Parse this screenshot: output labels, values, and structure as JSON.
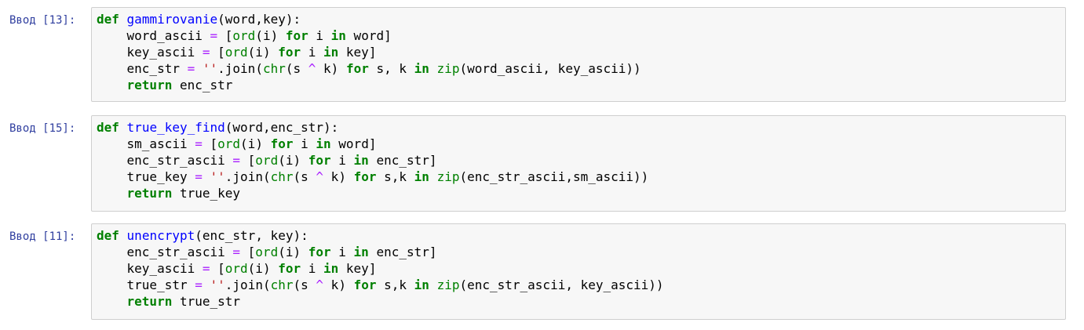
{
  "cells": [
    {
      "prompt": "Ввод [13]:",
      "lines": [
        [
          [
            "kw",
            "def"
          ],
          [
            "pn",
            " "
          ],
          [
            "fn",
            "gammirovanie"
          ],
          [
            "pn",
            "(word,key):"
          ]
        ],
        [
          [
            "pn",
            "    word_ascii "
          ],
          [
            "op",
            "="
          ],
          [
            "pn",
            " ["
          ],
          [
            "bi",
            "ord"
          ],
          [
            "pn",
            "(i) "
          ],
          [
            "kw",
            "for"
          ],
          [
            "pn",
            " i "
          ],
          [
            "kw",
            "in"
          ],
          [
            "pn",
            " word]"
          ]
        ],
        [
          [
            "pn",
            "    key_ascii "
          ],
          [
            "op",
            "="
          ],
          [
            "pn",
            " ["
          ],
          [
            "bi",
            "ord"
          ],
          [
            "pn",
            "(i) "
          ],
          [
            "kw",
            "for"
          ],
          [
            "pn",
            " i "
          ],
          [
            "kw",
            "in"
          ],
          [
            "pn",
            " key]"
          ]
        ],
        [
          [
            "pn",
            "    enc_str "
          ],
          [
            "op",
            "="
          ],
          [
            "pn",
            " "
          ],
          [
            "st",
            "''"
          ],
          [
            "pn",
            "."
          ],
          [
            "pn",
            "join("
          ],
          [
            "bi",
            "chr"
          ],
          [
            "pn",
            "(s "
          ],
          [
            "op",
            "^"
          ],
          [
            "pn",
            " k) "
          ],
          [
            "kw",
            "for"
          ],
          [
            "pn",
            " s, k "
          ],
          [
            "kw",
            "in"
          ],
          [
            "pn",
            " "
          ],
          [
            "bi",
            "zip"
          ],
          [
            "pn",
            "(word_ascii, key_ascii))"
          ]
        ],
        [
          [
            "pn",
            "    "
          ],
          [
            "kw",
            "return"
          ],
          [
            "pn",
            " enc_str"
          ]
        ]
      ]
    },
    {
      "prompt": "Ввод [15]:",
      "lines": [
        [
          [
            "kw",
            "def"
          ],
          [
            "pn",
            " "
          ],
          [
            "fn",
            "true_key_find"
          ],
          [
            "pn",
            "(word,enc_str):"
          ]
        ],
        [
          [
            "pn",
            "    sm_ascii "
          ],
          [
            "op",
            "="
          ],
          [
            "pn",
            " ["
          ],
          [
            "bi",
            "ord"
          ],
          [
            "pn",
            "(i) "
          ],
          [
            "kw",
            "for"
          ],
          [
            "pn",
            " i "
          ],
          [
            "kw",
            "in"
          ],
          [
            "pn",
            " word]"
          ]
        ],
        [
          [
            "pn",
            "    enc_str_ascii "
          ],
          [
            "op",
            "="
          ],
          [
            "pn",
            " ["
          ],
          [
            "bi",
            "ord"
          ],
          [
            "pn",
            "(i) "
          ],
          [
            "kw",
            "for"
          ],
          [
            "pn",
            " i "
          ],
          [
            "kw",
            "in"
          ],
          [
            "pn",
            " enc_str]"
          ]
        ],
        [
          [
            "pn",
            "    true_key "
          ],
          [
            "op",
            "="
          ],
          [
            "pn",
            " "
          ],
          [
            "st",
            "''"
          ],
          [
            "pn",
            "."
          ],
          [
            "pn",
            "join("
          ],
          [
            "bi",
            "chr"
          ],
          [
            "pn",
            "(s "
          ],
          [
            "op",
            "^"
          ],
          [
            "pn",
            " k) "
          ],
          [
            "kw",
            "for"
          ],
          [
            "pn",
            " s,k "
          ],
          [
            "kw",
            "in"
          ],
          [
            "pn",
            " "
          ],
          [
            "bi",
            "zip"
          ],
          [
            "pn",
            "(enc_str_ascii,sm_ascii))"
          ]
        ],
        [
          [
            "pn",
            "    "
          ],
          [
            "kw",
            "return"
          ],
          [
            "pn",
            " true_key"
          ]
        ]
      ]
    },
    {
      "prompt": "Ввод [11]:",
      "lines": [
        [
          [
            "kw",
            "def"
          ],
          [
            "pn",
            " "
          ],
          [
            "fn",
            "unencrypt"
          ],
          [
            "pn",
            "(enc_str, key):"
          ]
        ],
        [
          [
            "pn",
            "    enc_str_ascii "
          ],
          [
            "op",
            "="
          ],
          [
            "pn",
            " ["
          ],
          [
            "bi",
            "ord"
          ],
          [
            "pn",
            "(i) "
          ],
          [
            "kw",
            "for"
          ],
          [
            "pn",
            " i "
          ],
          [
            "kw",
            "in"
          ],
          [
            "pn",
            " enc_str]"
          ]
        ],
        [
          [
            "pn",
            "    key_ascii "
          ],
          [
            "op",
            "="
          ],
          [
            "pn",
            " ["
          ],
          [
            "bi",
            "ord"
          ],
          [
            "pn",
            "(i) "
          ],
          [
            "kw",
            "for"
          ],
          [
            "pn",
            " i "
          ],
          [
            "kw",
            "in"
          ],
          [
            "pn",
            " key]"
          ]
        ],
        [
          [
            "pn",
            "    true_str "
          ],
          [
            "op",
            "="
          ],
          [
            "pn",
            " "
          ],
          [
            "st",
            "''"
          ],
          [
            "pn",
            "."
          ],
          [
            "pn",
            "join("
          ],
          [
            "bi",
            "chr"
          ],
          [
            "pn",
            "(s "
          ],
          [
            "op",
            "^"
          ],
          [
            "pn",
            " k) "
          ],
          [
            "kw",
            "for"
          ],
          [
            "pn",
            " s,k "
          ],
          [
            "kw",
            "in"
          ],
          [
            "pn",
            " "
          ],
          [
            "bi",
            "zip"
          ],
          [
            "pn",
            "(enc_str_ascii, key_ascii))"
          ]
        ],
        [
          [
            "pn",
            "    "
          ],
          [
            "kw",
            "return"
          ],
          [
            "pn",
            " true_str"
          ]
        ]
      ]
    }
  ]
}
